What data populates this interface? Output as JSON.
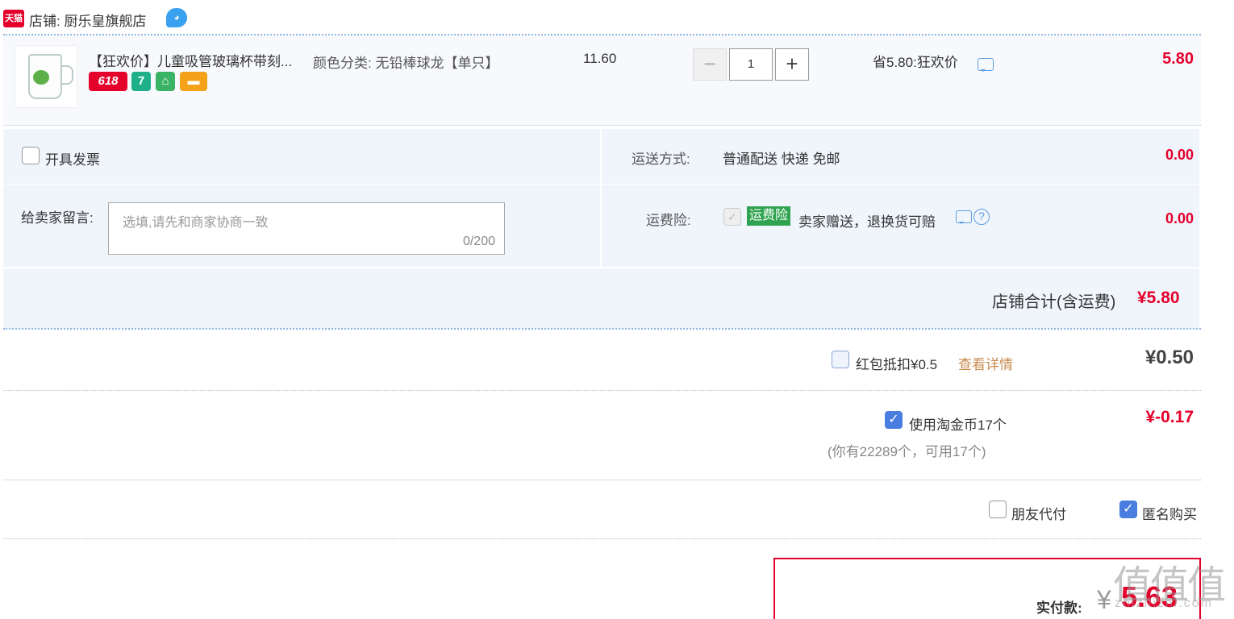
{
  "store": {
    "logo_text": "天猫",
    "name": "店铺: 厨乐皇旗舰店"
  },
  "item": {
    "title": "【狂欢价】儿童吸管玻璃杯带刻...",
    "sku": "颜色分类: 无铅棒球龙【单只】",
    "badges": [
      "618",
      "7"
    ],
    "unit_price": "11.60",
    "quantity": "1",
    "promo": "省5.80:狂欢价",
    "total": "5.80"
  },
  "invoice": {
    "label": "开具发票"
  },
  "shipping": {
    "label": "运送方式:",
    "value": "普通配送 快递 免邮",
    "amount": "0.00"
  },
  "message": {
    "label": "给卖家留言:",
    "placeholder": "选填,请先和商家协商一致",
    "count": "0/200"
  },
  "insurance": {
    "label": "运费险:",
    "badge": "运费险",
    "desc": "卖家赠送，退换货可赔",
    "amount": "0.00"
  },
  "store_total": {
    "label": "店铺合计(含运费)",
    "value": "¥5.80"
  },
  "redpacket": {
    "label": "红包抵扣¥0.5",
    "link": "查看详情",
    "value": "¥0.50"
  },
  "coins": {
    "label": "使用淘金币17个",
    "sub": "(你有22289个，可用17个)",
    "value": "¥-0.17"
  },
  "options": {
    "friend_pay": "朋友代付",
    "anonymous": "匿名购买"
  },
  "payment": {
    "label": "实付款:",
    "currency": "¥",
    "value": "5.63"
  },
  "watermark": {
    "top": "值值值",
    "bottom": "zhizhizhi.com"
  },
  "colors": {
    "accent_red": "#e4002b",
    "check_blue": "#4a7de0",
    "panel_bg": "#f0f5fc"
  }
}
